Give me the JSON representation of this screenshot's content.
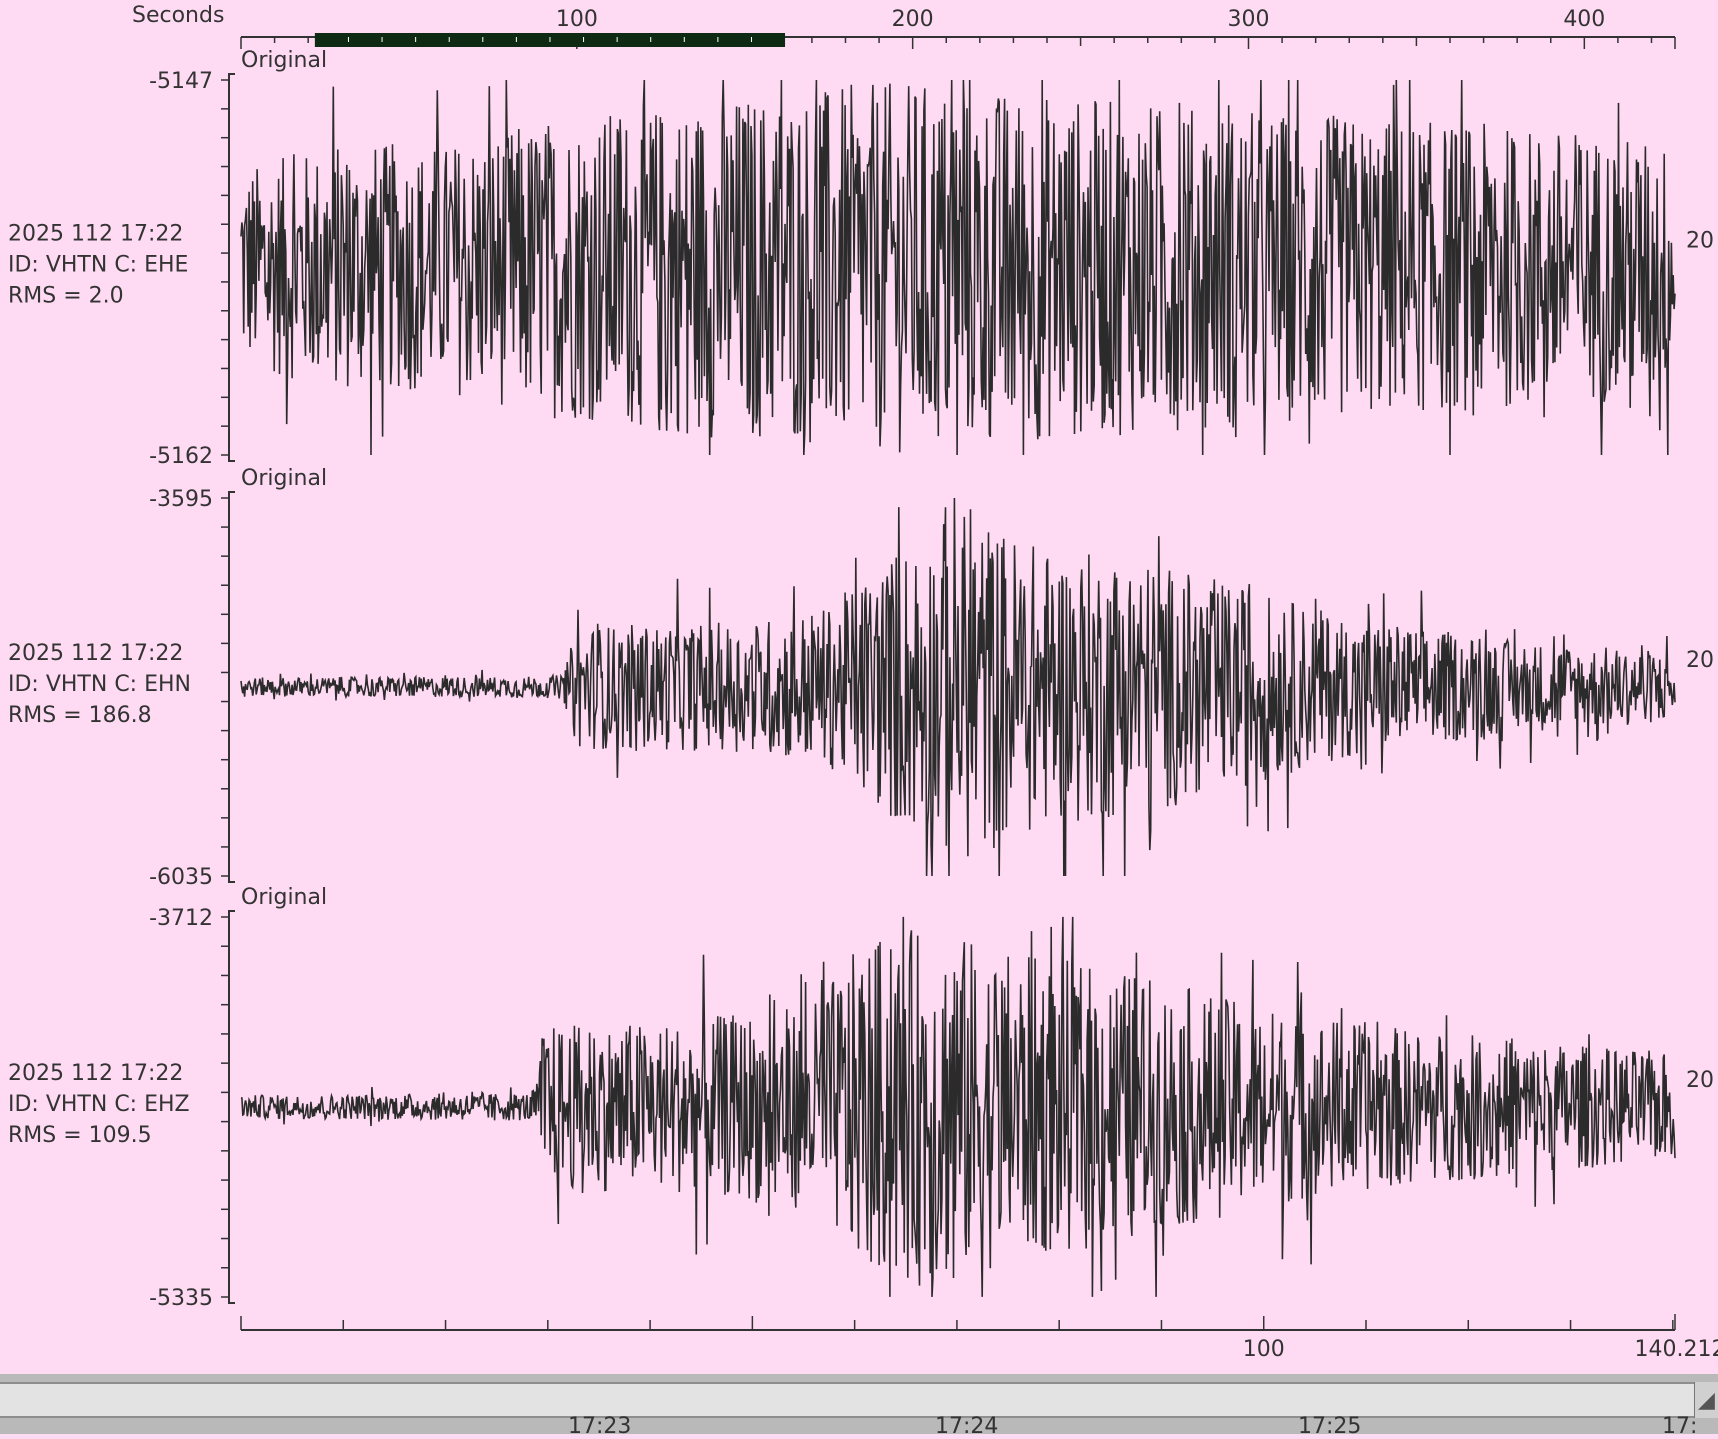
{
  "chart_data": {
    "type": "line",
    "top_axis": {
      "label": "Seconds",
      "ticks": [
        100,
        200,
        300,
        400
      ],
      "xlim": [
        0,
        427
      ]
    },
    "bottom_axis": {
      "tick_labels": [
        "100",
        "140.21223552"
      ],
      "tick_values": [
        100,
        140.21223552
      ],
      "xlim": [
        0,
        140.21223552
      ]
    },
    "selection_range_seconds": [
      22,
      162
    ],
    "traces": [
      {
        "label": "Original",
        "date_line": "2025 112 17:22",
        "id_line": "ID: VHTN C: EHE",
        "rms_line": "RMS = 2.0",
        "right_label": "20",
        "ymax_label": "-5147",
        "ymin_label": "-5162",
        "ylim": [
          -5162,
          -5147
        ],
        "baseline": -5154.5,
        "envelope": [
          [
            0,
            4.0
          ],
          [
            30,
            5.0
          ],
          [
            60,
            5.0
          ],
          [
            90,
            6.0
          ],
          [
            150,
            7.0
          ],
          [
            200,
            7.5
          ],
          [
            280,
            6.5
          ],
          [
            340,
            6.0
          ],
          [
            400,
            5.5
          ],
          [
            427,
            5.0
          ]
        ]
      },
      {
        "label": "Original",
        "date_line": "2025 112 17:22",
        "id_line": "ID: VHTN C: EHN",
        "rms_line": "RMS = 186.8",
        "right_label": "20",
        "ymax_label": "-3595",
        "ymin_label": "-6035",
        "ylim": [
          -6035,
          -3595
        ],
        "baseline": -4815,
        "envelope": [
          [
            0,
            60
          ],
          [
            90,
            70
          ],
          [
            96,
            80
          ],
          [
            100,
            400
          ],
          [
            150,
            420
          ],
          [
            175,
            520
          ],
          [
            195,
            900
          ],
          [
            215,
            1150
          ],
          [
            240,
            900
          ],
          [
            265,
            850
          ],
          [
            290,
            700
          ],
          [
            330,
            450
          ],
          [
            380,
            300
          ],
          [
            427,
            230
          ]
        ]
      },
      {
        "label": "Original",
        "date_line": "2025 112 17:22",
        "id_line": "ID: VHTN C: EHZ",
        "rms_line": "RMS = 109.5",
        "right_label": "20",
        "ymax_label": "-3712",
        "ymin_label": "-5335",
        "ylim": [
          -5335,
          -3712
        ],
        "baseline": -4523,
        "envelope": [
          [
            0,
            50
          ],
          [
            85,
            60
          ],
          [
            88,
            80
          ],
          [
            90,
            350
          ],
          [
            130,
            370
          ],
          [
            170,
            440
          ],
          [
            185,
            700
          ],
          [
            205,
            780
          ],
          [
            230,
            660
          ],
          [
            260,
            600
          ],
          [
            300,
            440
          ],
          [
            350,
            330
          ],
          [
            427,
            230
          ]
        ]
      }
    ]
  },
  "status_bar": {
    "times": [
      "17:23",
      "17:24",
      "17:25",
      "17:"
    ]
  }
}
